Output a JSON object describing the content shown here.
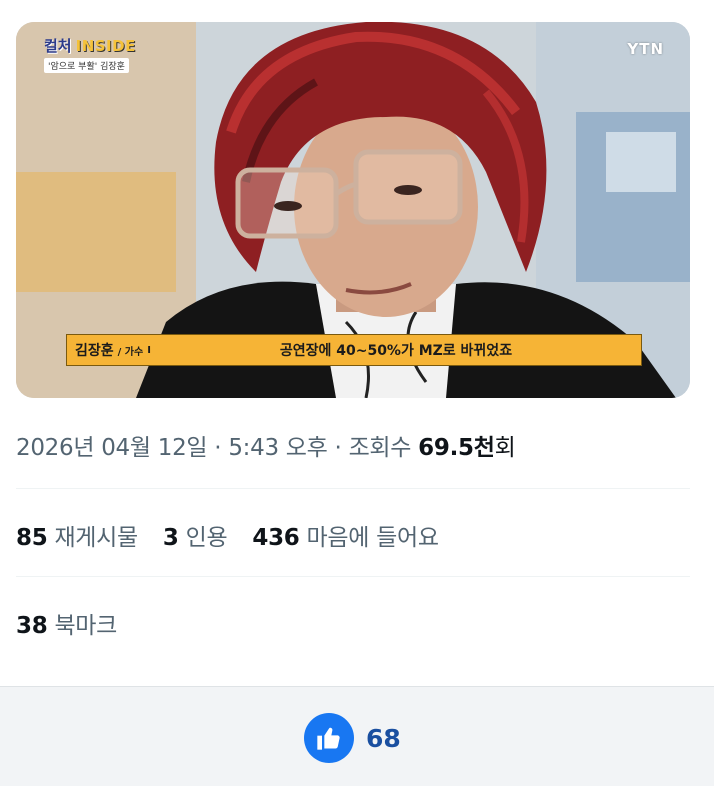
{
  "media": {
    "program_logo": {
      "korean": "컬처",
      "english": "INSIDE",
      "subtitle": "'암으로 부활' 김장훈"
    },
    "channel_watermark": "YTN",
    "caption": {
      "name": "김장훈",
      "role": "/ 가수",
      "separator": "I",
      "quote": "공연장에 40~50%가 MZ로 바뀌었죠"
    }
  },
  "post_meta": {
    "date": "2026년 04월 12일",
    "sep1": " · ",
    "time": "5:43 오후",
    "sep2": " · ",
    "views_label": "조회수 ",
    "views_value": "69.5천",
    "views_unit": "회"
  },
  "stats": {
    "reposts": {
      "count": "85",
      "label": "재게시물"
    },
    "quotes": {
      "count": "3",
      "label": "인용"
    },
    "likes": {
      "count": "436",
      "label": "마음에 들어요"
    },
    "bookmarks": {
      "count": "38",
      "label": "북마크"
    }
  },
  "reaction_bar": {
    "icon": "thumbs-up-icon",
    "count": "68",
    "accent_color": "#1877f2"
  }
}
